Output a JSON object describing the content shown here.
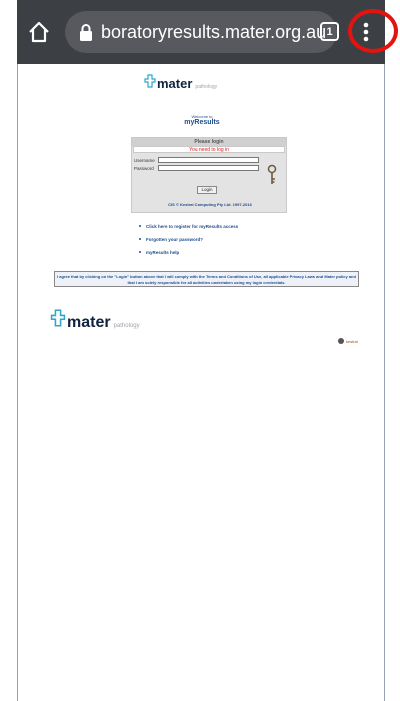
{
  "browser": {
    "url": "boratoryresults.mater.org.au",
    "tab_count": "1",
    "icons": [
      "home-icon",
      "lock-icon",
      "tab-switcher-icon",
      "more-menu-icon"
    ]
  },
  "page": {
    "logo": {
      "name": "mater",
      "subtitle": "pathology"
    },
    "welcome": {
      "line": "Welcome to",
      "title": "myResults"
    },
    "login": {
      "heading": "Please login",
      "message": "You need to log in",
      "username_label": "Username",
      "password_label": "Password",
      "button": "Login",
      "copyright": "CIS © Kestral Computing Pty Ltd. 1997-2016"
    },
    "links": [
      "Click here to register for myResults access",
      "Forgotten your password?",
      "myResults help"
    ],
    "terms": "I agree that by clicking on the \"Login\" button above that I will comply with the Terms and Conditions of Use, all applicable Privacy Laws and Mater policy and that I am solely responsible for all activities undertaken using my login credentials.",
    "footer_logo": {
      "name": "mater",
      "subtitle": "pathology"
    },
    "vendor": "kestral"
  },
  "colors": {
    "toolbar": "#3c3f44",
    "highlight_ring": "#e3140f",
    "link": "#1f4d8f"
  }
}
